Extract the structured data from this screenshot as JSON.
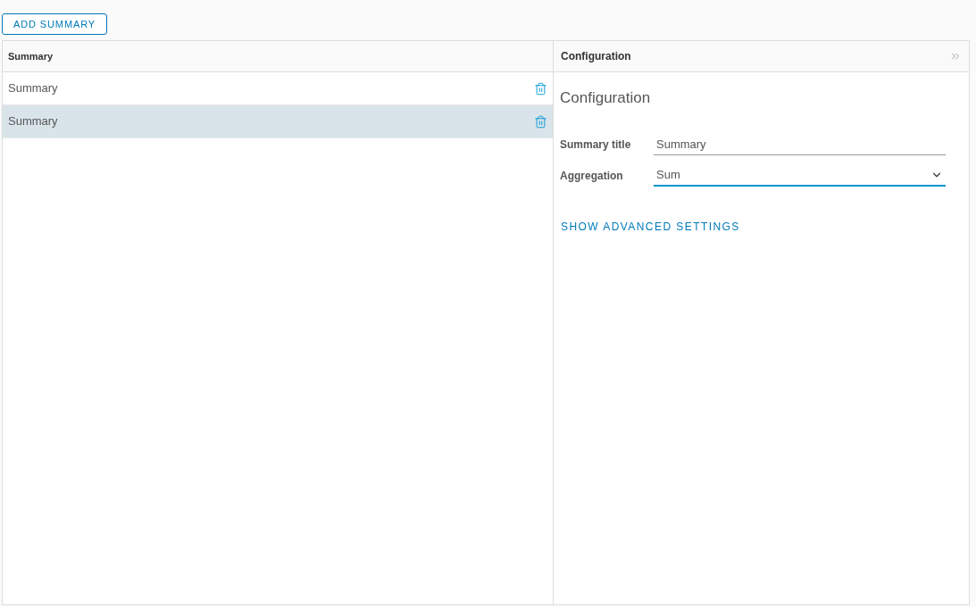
{
  "add_button": "ADD SUMMARY",
  "list": {
    "header": "Summary",
    "rows": [
      {
        "label": "Summary",
        "selected": false
      },
      {
        "label": "Summary",
        "selected": true
      }
    ]
  },
  "config": {
    "header": "Configuration",
    "heading": "Configuration",
    "fields": [
      {
        "kind": "text",
        "label": "Summary title",
        "value": "Summary",
        "focused": false
      },
      {
        "kind": "select",
        "label": "Aggregation",
        "value": "Sum",
        "focused": true
      }
    ],
    "link": "SHOW ADVANCED SETTINGS"
  }
}
